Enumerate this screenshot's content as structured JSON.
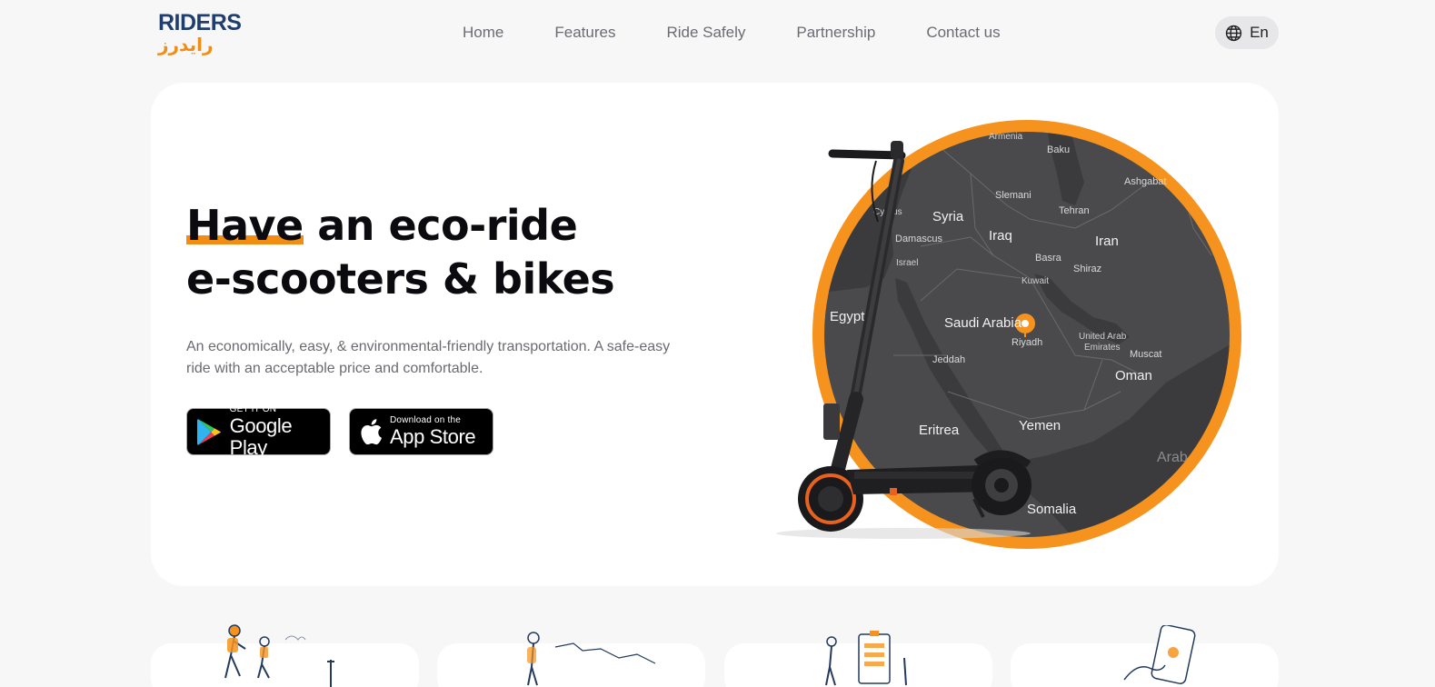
{
  "brand": {
    "name": "RIDERS",
    "name_arabic": "رايدرز",
    "colors": {
      "primary": "#1f3e6e",
      "accent": "#f28c13"
    }
  },
  "nav": {
    "items": [
      {
        "label": "Home"
      },
      {
        "label": "Features"
      },
      {
        "label": "Ride Safely"
      },
      {
        "label": "Partnership"
      },
      {
        "label": "Contact us"
      }
    ]
  },
  "language": {
    "label": "En",
    "icon": "globe-icon"
  },
  "hero": {
    "headline_first": "Have",
    "headline_rest": " an eco-ride",
    "headline_line2": "e-scooters & bikes",
    "subtext": "An economically, easy, & environmental-friendly transportation. A safe-easy ride with an acceptable price and comfortable.",
    "google_play": {
      "small": "GET IT ON",
      "big": "Google Play",
      "icon": "google-play-icon"
    },
    "app_store": {
      "small": "Download on the",
      "big": "App Store",
      "icon": "apple-icon"
    }
  },
  "map": {
    "labels": {
      "armenia": "Armenia",
      "baku": "Baku",
      "ashgabat": "Ashgabat",
      "slemani": "Slemani",
      "tehran": "Tehran",
      "cyprus": "Cyprus",
      "syria": "Syria",
      "iraq": "Iraq",
      "iran": "Iran",
      "damascus": "Damascus",
      "israel": "Israel",
      "basra": "Basra",
      "shiraz": "Shiraz",
      "kuwait": "Kuwait",
      "egypt": "Egypt",
      "saudi": "Saudi Arabia",
      "riyadh": "Riyadh",
      "uae_1": "United Arab",
      "uae_2": "Emirates",
      "muscat": "Muscat",
      "jeddah": "Jeddah",
      "oman": "Oman",
      "eritrea": "Eritrea",
      "yemen": "Yemen",
      "somalia": "Somalia",
      "arabian": "Arab"
    },
    "marker_icon": "location-pin-icon",
    "ring_color": "#f5931e",
    "map_color": "#4a4a4c"
  }
}
